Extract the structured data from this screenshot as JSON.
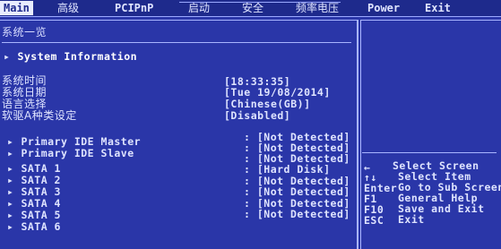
{
  "menu": [
    {
      "label": "Main",
      "active": true
    },
    {
      "label": "高级"
    },
    {
      "label": "PCIPnP"
    },
    {
      "label": "启动"
    },
    {
      "label": "安全"
    },
    {
      "label": "频率电压"
    },
    {
      "label": "Power"
    },
    {
      "label": "Exit"
    }
  ],
  "panel_title": "系统一览",
  "system_information": "System Information",
  "fields": [
    {
      "label": "系统时间",
      "value": "[18:33:35]"
    },
    {
      "label": "系统日期",
      "value": "[Tue 19/08/2014]"
    },
    {
      "label": "语言选择",
      "value": "[Chinese(GB)]"
    },
    {
      "label": "软驱A种类设定",
      "value": "[Disabled]"
    }
  ],
  "devices": [
    {
      "label": "Primary IDE Master",
      "value": "[Not Detected]"
    },
    {
      "label": "Primary IDE Slave",
      "value": "[Not Detected]"
    },
    {
      "label": "",
      "value": "[Not Detected]"
    },
    {
      "label": "SATA 1",
      "value": "[Hard Disk]"
    },
    {
      "label": "SATA 2",
      "value": "[Not Detected]"
    },
    {
      "label": "SATA 3",
      "value": "[Not Detected]"
    },
    {
      "label": "SATA 4",
      "value": "[Not Detected]"
    },
    {
      "label": "SATA 5",
      "value": "[Not Detected]"
    },
    {
      "label": "SATA 6",
      "value": ""
    }
  ],
  "help": [
    {
      "key": "←",
      "desc": "Select Screen"
    },
    {
      "key": "↑↓",
      "desc": "Select Item"
    },
    {
      "key": "Enter",
      "desc": "Go to Sub Screen"
    },
    {
      "key": "F1",
      "desc": "General Help"
    },
    {
      "key": "F10",
      "desc": "Save and Exit"
    },
    {
      "key": "ESC",
      "desc": "Exit"
    }
  ],
  "colors": {
    "background": "#2a36a8",
    "text": "#dfe4ff",
    "border": "#a9b5ff"
  }
}
